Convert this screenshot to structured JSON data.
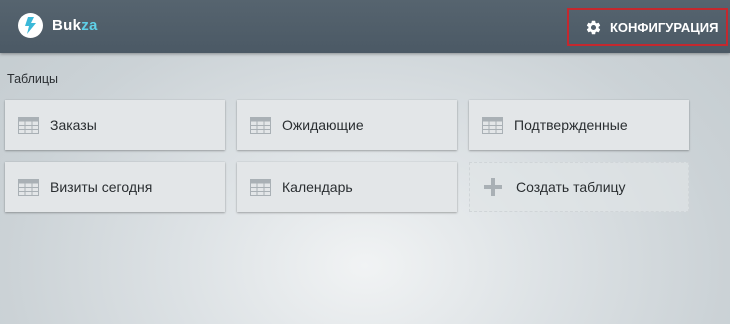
{
  "app": {
    "logo_text_main": "Buk",
    "logo_text_accent": "za"
  },
  "header": {
    "config_label": "КОНФИГУРАЦИЯ"
  },
  "tables": {
    "section_title": "Таблицы",
    "items": [
      {
        "label": "Заказы"
      },
      {
        "label": "Ожидающие"
      },
      {
        "label": "Подтвержденные"
      },
      {
        "label": "Визиты сегодня"
      },
      {
        "label": "Календарь"
      }
    ],
    "create_label": "Создать таблицу"
  },
  "colors": {
    "topbar": "#4f5d69",
    "logo_accent": "#5fd0e8",
    "highlight_border": "#c4282e",
    "tile_bg": "#e3e6e8",
    "icon_gray": "#a9b0b5"
  }
}
